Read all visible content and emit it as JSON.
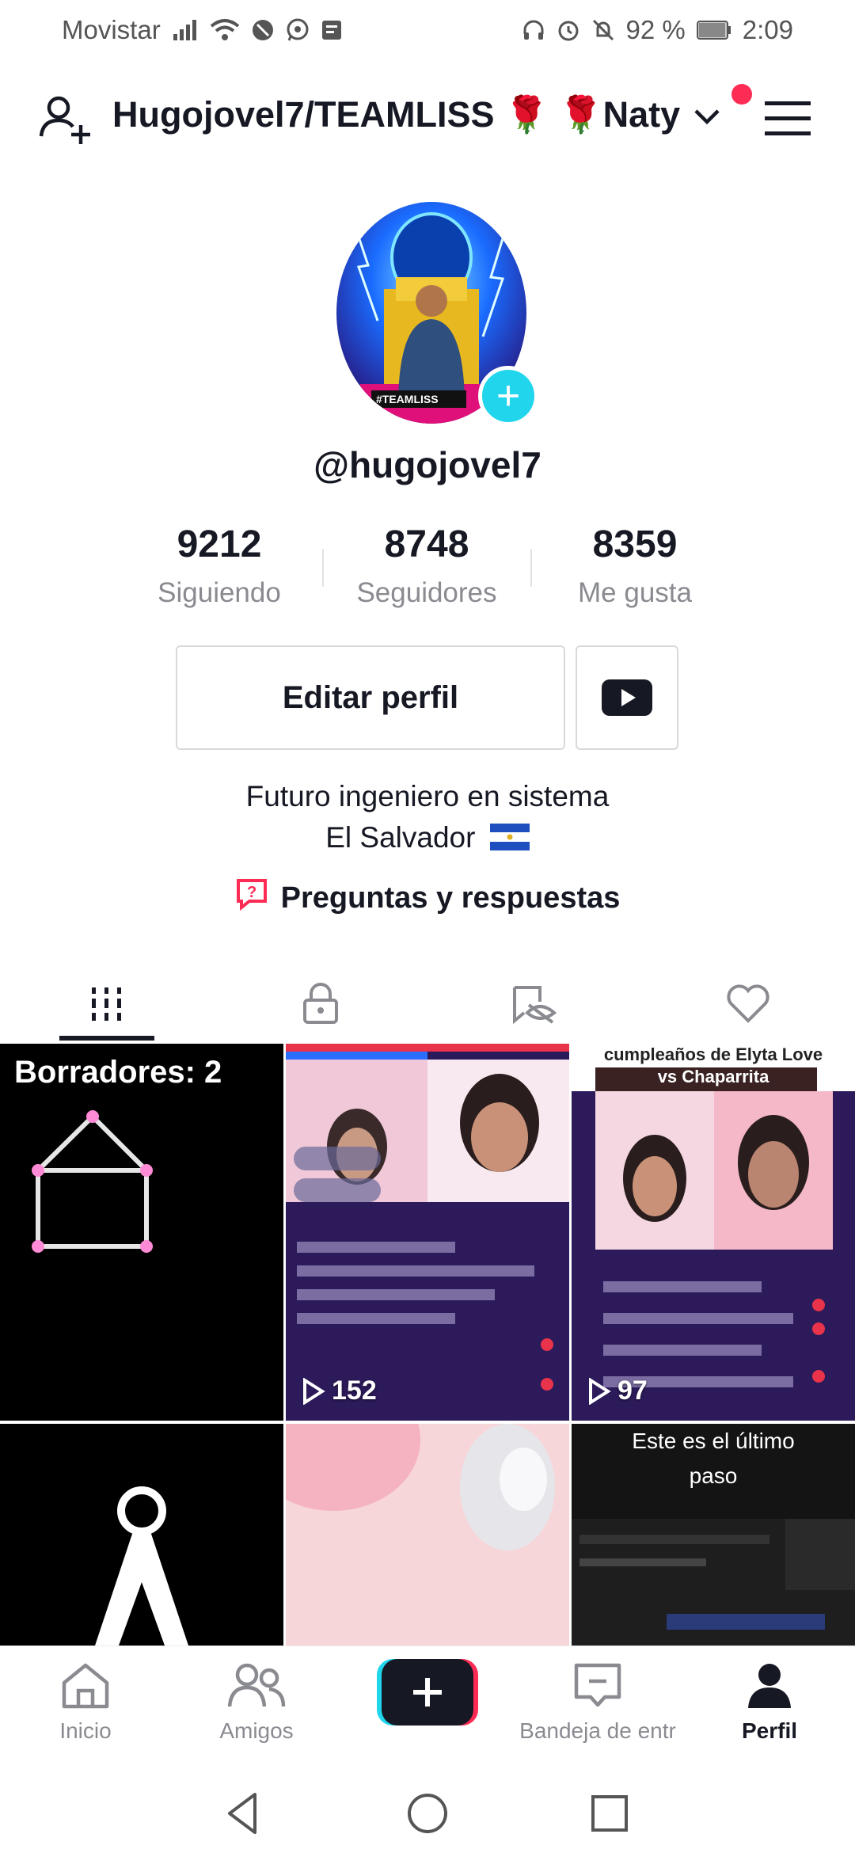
{
  "status_bar": {
    "carrier": "Movistar",
    "battery": "92 %",
    "time": "2:09"
  },
  "header": {
    "account_name": "Hugojovel7/TEAMLISS 🌹 🌹Naty"
  },
  "profile": {
    "avatar_badge": "#TEAMLISS",
    "username": "@hugojovel7",
    "stats": [
      {
        "value": "9212",
        "label": "Siguiendo"
      },
      {
        "value": "8748",
        "label": "Seguidores"
      },
      {
        "value": "8359",
        "label": "Me gusta"
      }
    ],
    "edit_button": "Editar perfil",
    "bio_line1": "Futuro ingeniero en sistema",
    "bio_line2": "El Salvador",
    "qa_link": "Preguntas y respuestas"
  },
  "grid": {
    "drafts_label": "Borradores: 2",
    "video2_views": "152",
    "video3_title_line1": "cumpleaños de Elyta Love",
    "video3_title_line2": "vs Chaparrita",
    "video3_views": "97",
    "video6_text_line1": "Este es el último",
    "video6_text_line2": "paso"
  },
  "bottom_nav": {
    "home": "Inicio",
    "friends": "Amigos",
    "inbox": "Bandeja de entr",
    "profile": "Perfil"
  },
  "colors": {
    "accent_red": "#fe2c55",
    "accent_cyan": "#20d5ec",
    "text_primary": "#161823",
    "text_secondary": "#8a8b91"
  }
}
